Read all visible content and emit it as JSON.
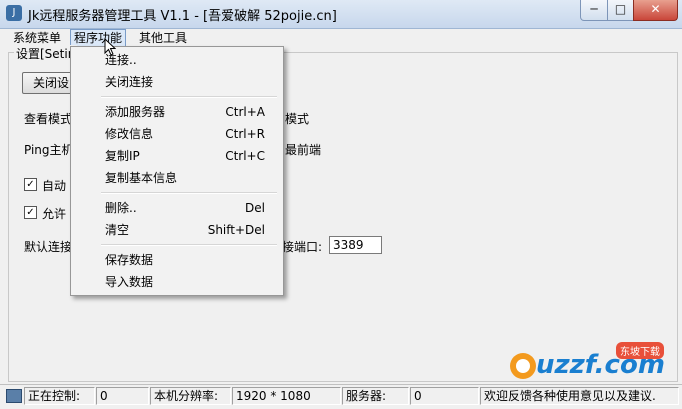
{
  "window": {
    "title": "Jk远程服务器管理工具 V1.1 - [吾爱破解 52pojie.cn]",
    "minimize": "─",
    "maximize": "□",
    "close": "✕"
  },
  "menubar": {
    "items": [
      "系统菜单",
      "程序功能",
      "其他工具"
    ]
  },
  "settings": {
    "group_title": "设置[Setin",
    "close_btn": "关闭设",
    "view_mode_label": "查看模式",
    "view_mode_right": "模式",
    "ping_label": "Ping主机",
    "ping_right": "最前端",
    "auto_label": "自动",
    "allow_label": "允许",
    "default_conn_label": "默认连接",
    "port_label": "接端口:",
    "port_value": "3389"
  },
  "dropdown": {
    "items": [
      {
        "label": "连接..",
        "shortcut": ""
      },
      {
        "label": "关闭连接",
        "shortcut": ""
      },
      {
        "label": "添加服务器",
        "shortcut": "Ctrl+A"
      },
      {
        "label": "修改信息",
        "shortcut": "Ctrl+R"
      },
      {
        "label": "复制IP",
        "shortcut": "Ctrl+C"
      },
      {
        "label": "复制基本信息",
        "shortcut": ""
      },
      {
        "label": "删除..",
        "shortcut": "Del"
      },
      {
        "label": "清空",
        "shortcut": "Shift+Del"
      },
      {
        "label": "保存数据",
        "shortcut": ""
      },
      {
        "label": "导入数据",
        "shortcut": ""
      }
    ]
  },
  "statusbar": {
    "controlling_label": "正在控制:",
    "controlling_value": "0",
    "resolution_label": "本机分辨率:",
    "resolution_value": "1920 * 1080",
    "server_label": "服务器:",
    "server_value": "0",
    "welcome": "欢迎反馈各种使用意见以及建议."
  },
  "watermark": {
    "text": "uzzf.com",
    "tag": "东坡下载"
  },
  "colors": {
    "title_gradient_top": "#dfe9f5",
    "close_button": "#c9463a",
    "watermark_blue": "#1a7fd0"
  }
}
